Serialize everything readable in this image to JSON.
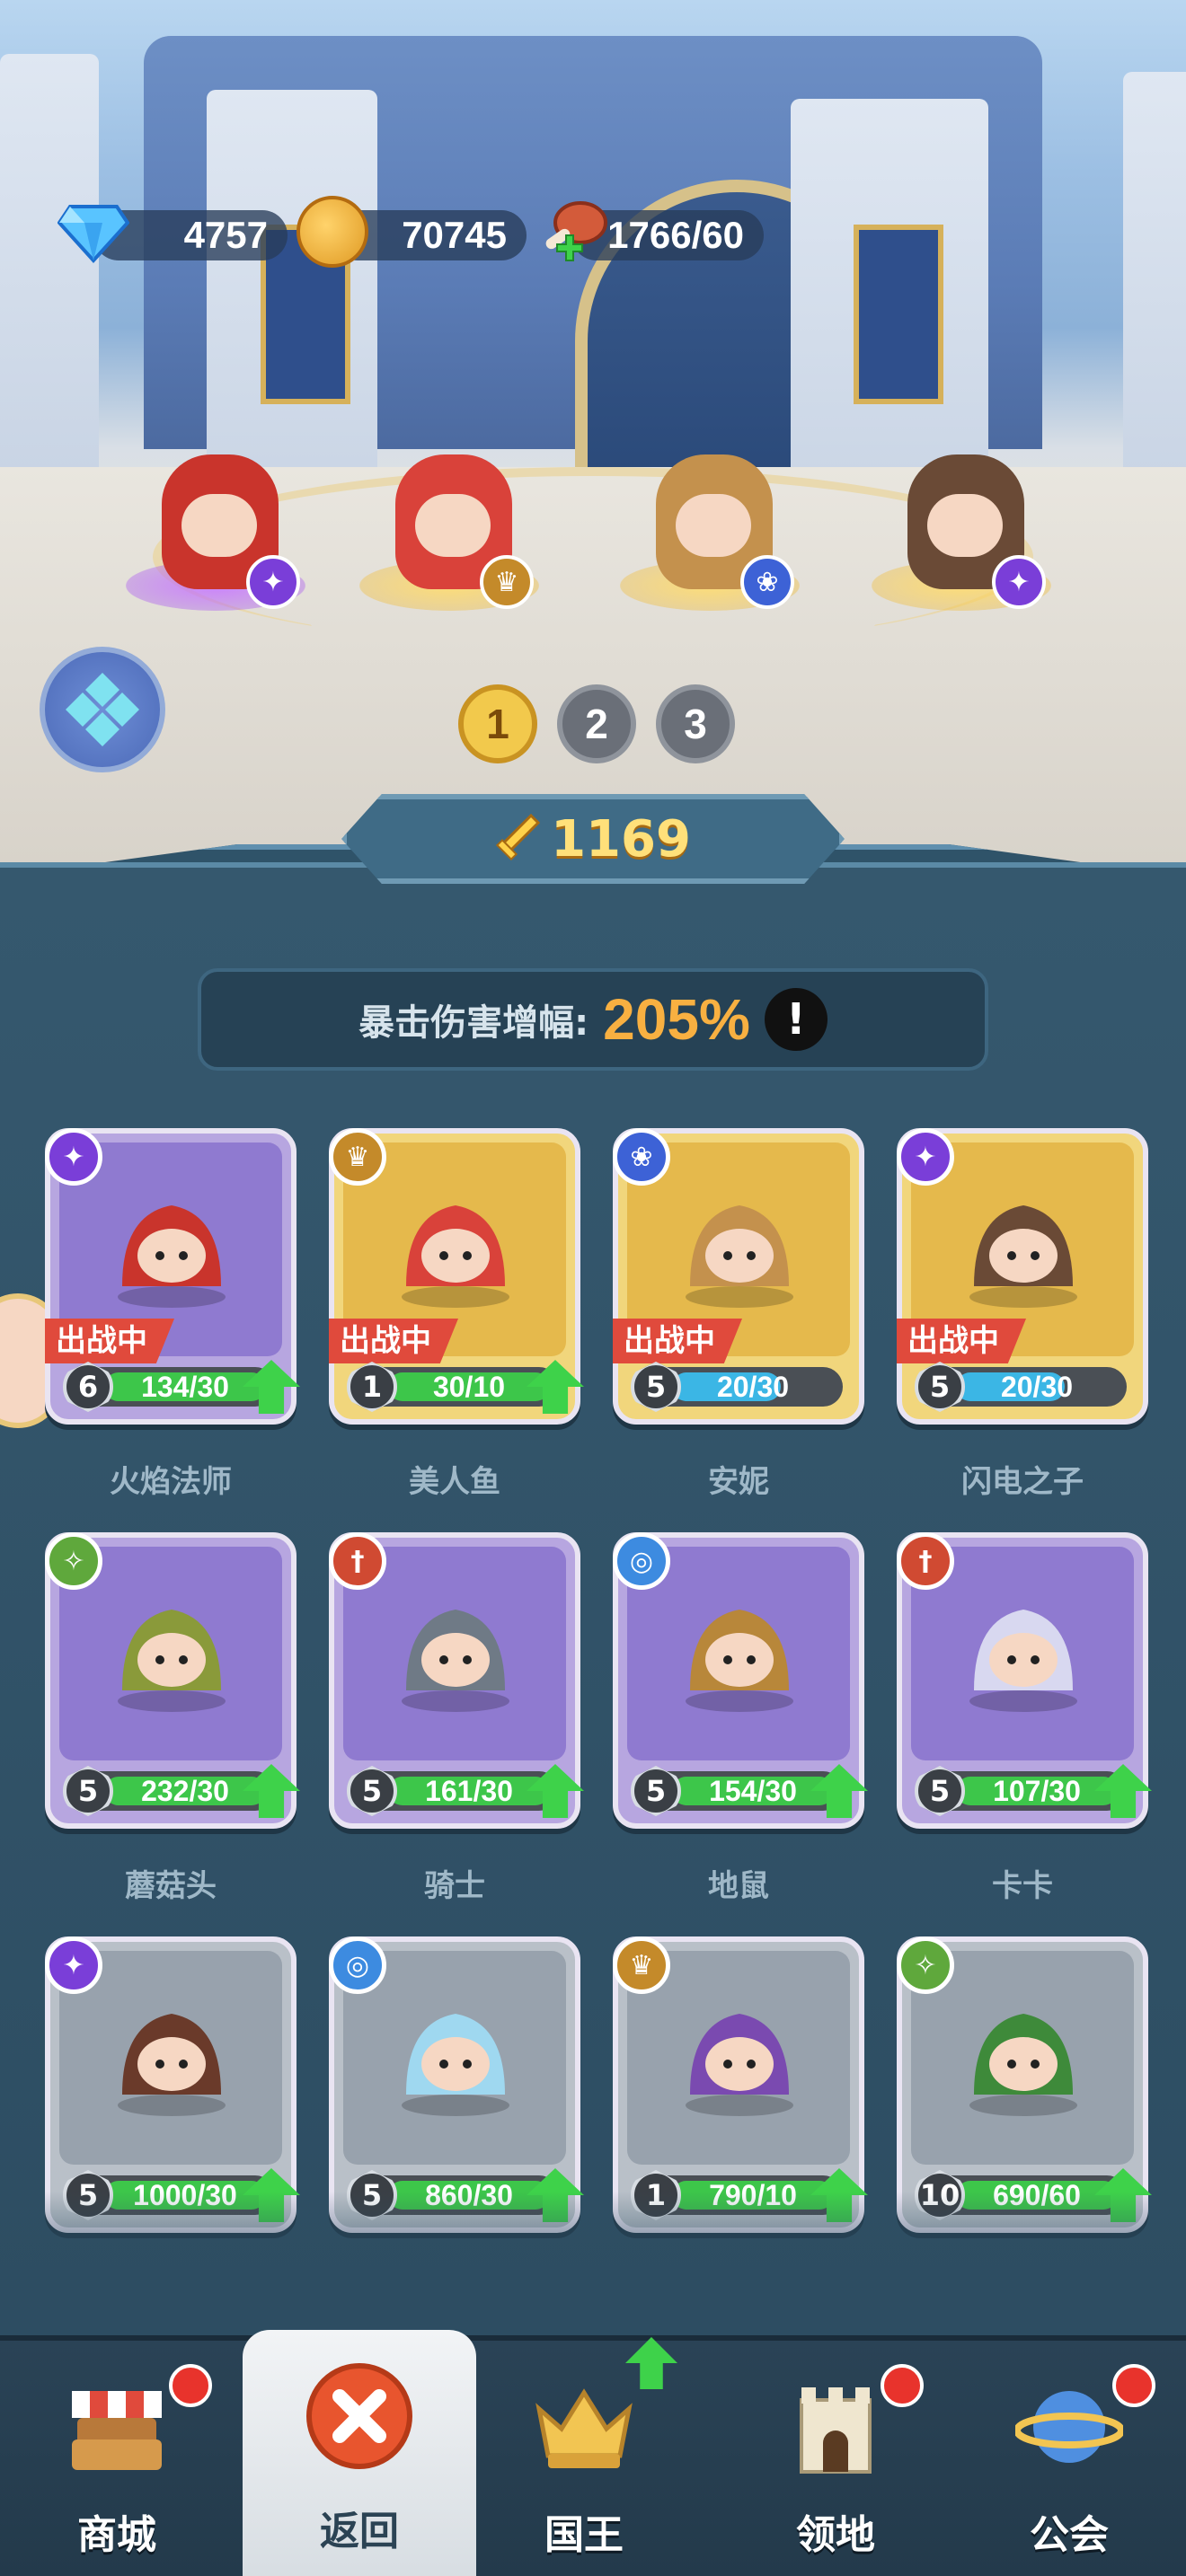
{
  "currency": {
    "gems": "4757",
    "gold": "70745",
    "stamina": "1766/60",
    "icons": [
      "diamond-icon",
      "gold-coin-icon",
      "meat-icon"
    ]
  },
  "team_tabs": [
    "1",
    "2",
    "3"
  ],
  "active_team": "1",
  "power": "1169",
  "stat": {
    "label": "暴击伤害增幅:",
    "value": "205%",
    "info": "!"
  },
  "lineup": [
    {
      "name": "火焰法师",
      "class_icon": "magic-class-icon",
      "base": "purple"
    },
    {
      "name": "美人鱼",
      "class_icon": "support-class-icon",
      "base": "gold"
    },
    {
      "name": "安妮",
      "class_icon": "paw-class-icon",
      "base": "gold"
    },
    {
      "name": "闪电之子",
      "class_icon": "magic-class-icon",
      "base": "gold"
    }
  ],
  "heroes": [
    {
      "name": "火焰法师",
      "level": "6",
      "progress": "134/30",
      "fill": 1.0,
      "fill_color": "green",
      "rarity": "purple",
      "in_battle": true,
      "badge_text": "出战中",
      "upgradable": true,
      "class": "magic"
    },
    {
      "name": "美人鱼",
      "level": "1",
      "progress": "30/10",
      "fill": 1.0,
      "fill_color": "green",
      "rarity": "gold",
      "in_battle": true,
      "badge_text": "出战中",
      "upgradable": true,
      "class": "support"
    },
    {
      "name": "安妮",
      "level": "5",
      "progress": "20/30",
      "fill": 0.67,
      "fill_color": "blue",
      "rarity": "gold",
      "in_battle": true,
      "badge_text": "出战中",
      "upgradable": false,
      "class": "paw"
    },
    {
      "name": "闪电之子",
      "level": "5",
      "progress": "20/30",
      "fill": 0.67,
      "fill_color": "blue",
      "rarity": "gold",
      "in_battle": true,
      "badge_text": "出战中",
      "upgradable": false,
      "class": "magic"
    },
    {
      "name": "蘑菇头",
      "level": "5",
      "progress": "232/30",
      "fill": 1.0,
      "fill_color": "green",
      "rarity": "purple",
      "in_battle": false,
      "upgradable": true,
      "class": "ranger"
    },
    {
      "name": "骑士",
      "level": "5",
      "progress": "161/30",
      "fill": 1.0,
      "fill_color": "green",
      "rarity": "purple",
      "in_battle": false,
      "upgradable": true,
      "class": "warrior"
    },
    {
      "name": "地鼠",
      "level": "5",
      "progress": "154/30",
      "fill": 1.0,
      "fill_color": "green",
      "rarity": "purple",
      "in_battle": false,
      "upgradable": true,
      "class": "swirl"
    },
    {
      "name": "卡卡",
      "level": "5",
      "progress": "107/30",
      "fill": 1.0,
      "fill_color": "green",
      "rarity": "purple",
      "in_battle": false,
      "upgradable": true,
      "class": "warrior"
    },
    {
      "name": "",
      "level": "5",
      "progress": "1000/30",
      "fill": 1.0,
      "fill_color": "green",
      "rarity": "gray",
      "in_battle": false,
      "upgradable": true,
      "class": "magic"
    },
    {
      "name": "",
      "level": "5",
      "progress": "860/30",
      "fill": 1.0,
      "fill_color": "green",
      "rarity": "gray",
      "in_battle": false,
      "upgradable": true,
      "class": "swirl"
    },
    {
      "name": "",
      "level": "1",
      "progress": "790/10",
      "fill": 1.0,
      "fill_color": "green",
      "rarity": "gray",
      "in_battle": false,
      "upgradable": true,
      "class": "support"
    },
    {
      "name": "",
      "level": "10",
      "progress": "690/60",
      "fill": 1.0,
      "fill_color": "green",
      "rarity": "gray",
      "in_battle": false,
      "upgradable": true,
      "class": "ranger"
    }
  ],
  "nav": [
    {
      "label": "商城",
      "icon": "shop-icon",
      "dot": true,
      "active": false
    },
    {
      "label": "返回",
      "icon": "close-icon",
      "dot": false,
      "active": true
    },
    {
      "label": "国王",
      "icon": "crown-icon",
      "dot": false,
      "up": true,
      "active": false
    },
    {
      "label": "领地",
      "icon": "castle-icon",
      "dot": true,
      "active": false
    },
    {
      "label": "公会",
      "icon": "planet-icon",
      "dot": true,
      "active": false
    }
  ],
  "colors": {
    "panel": "#2d4d62",
    "accent_gold": "#f8b041",
    "power_text": "#ffe07a",
    "in_battle_red": "#e04a3c",
    "upgrade_green": "#3ed24a"
  }
}
